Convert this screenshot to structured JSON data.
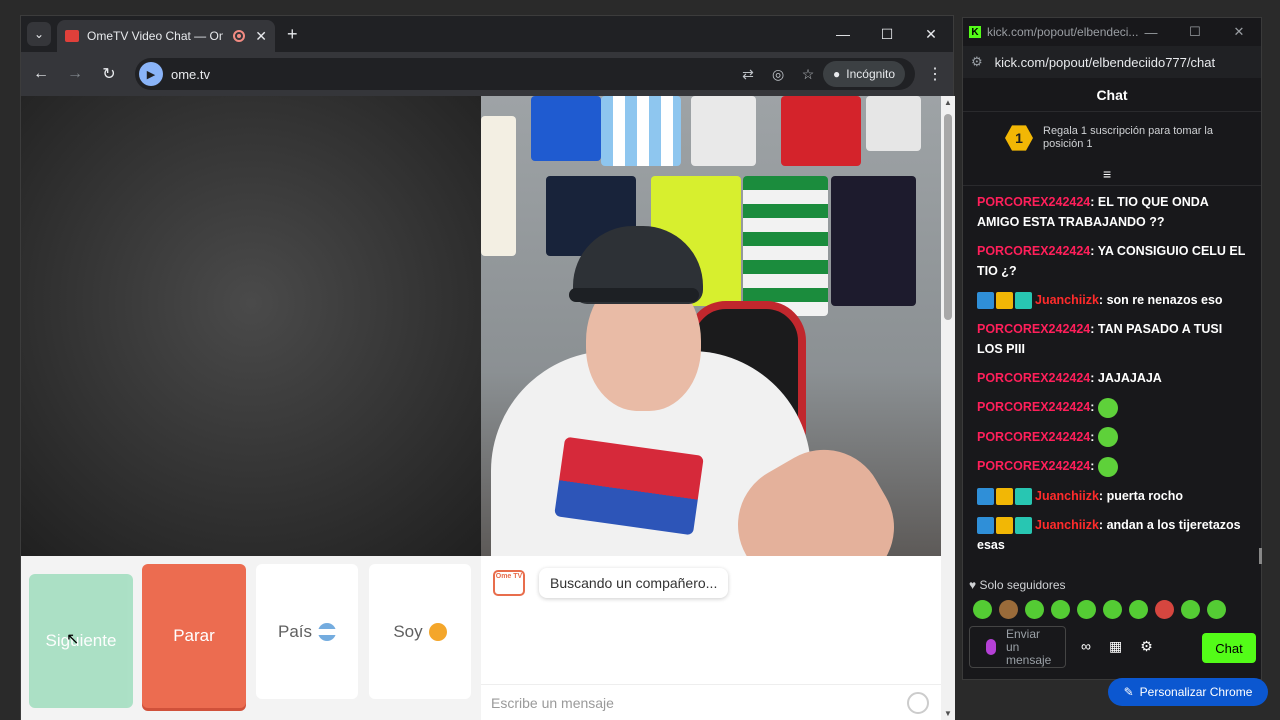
{
  "browser": {
    "tab_title": "OmeTV Video Chat — Ome",
    "tab_close": "✕",
    "new_tab": "+",
    "tab_menu": "⌄",
    "controls": {
      "min": "—",
      "max": "☐",
      "close": "✕"
    },
    "url": "ome.tv",
    "incognito": "Incógnito",
    "back": "←",
    "forward": "→",
    "reload": "↻"
  },
  "app": {
    "buttons": {
      "next": "Siguiente",
      "stop": "Parar",
      "country": "País",
      "gender": "Soy"
    },
    "status_message": "Buscando un compañero...",
    "logo_text": "Ome TV",
    "message_placeholder": "Escribe un mensaje"
  },
  "kick": {
    "window_title": "kick.com/popout/elbendeci...",
    "url": "kick.com/popout/elbendeciido777/chat",
    "header": "Chat",
    "pinned_rank": "1",
    "pinned_text": "Regala 1 suscripción para tomar la posición 1",
    "messages": [
      {
        "user": "PORCOREX242424",
        "text": "EL TIO QUE ONDA AMIGO ESTA TRABAJANDO ??",
        "badges": false,
        "emote": false
      },
      {
        "user": "PORCOREX242424",
        "text": "YA CONSIGUIO CELU EL TIO ¿?",
        "badges": false,
        "emote": false
      },
      {
        "user": "Juanchiizk",
        "text": "son re nenazos eso",
        "badges": true,
        "emote": false
      },
      {
        "user": "PORCOREX242424",
        "text": "TAN PASADO A TUSI LOS PIII",
        "badges": false,
        "emote": false
      },
      {
        "user": "PORCOREX242424",
        "text": "JAJAJAJA",
        "badges": false,
        "emote": false
      },
      {
        "user": "PORCOREX242424",
        "text": "",
        "badges": false,
        "emote": true
      },
      {
        "user": "PORCOREX242424",
        "text": "",
        "badges": false,
        "emote": true
      },
      {
        "user": "PORCOREX242424",
        "text": "",
        "badges": false,
        "emote": true
      },
      {
        "user": "Juanchiizk",
        "text": "puerta rocho",
        "badges": true,
        "emote": false
      },
      {
        "user": "Juanchiizk",
        "text": "andan a los tijeretazos esas",
        "badges": true,
        "emote": false
      }
    ],
    "followers_only": "Solo seguidores",
    "input_placeholder": "Enviar un mensaje",
    "chat_button": "Chat"
  },
  "chrome_button": "Personalizar Chrome",
  "colors": {
    "kick_green": "#53fc18",
    "ome_stop": "#ec6c50",
    "ome_next": "#a4dfc1"
  }
}
